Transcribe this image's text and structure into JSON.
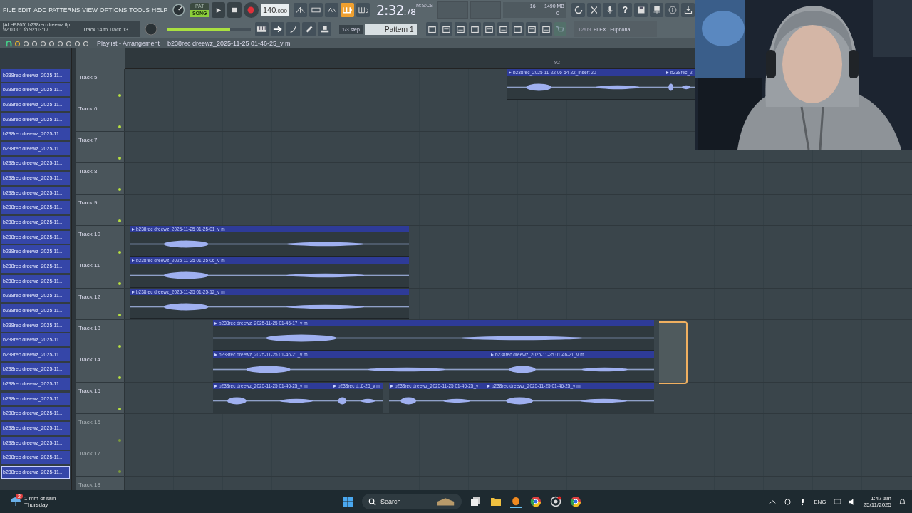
{
  "menu": [
    "FILE",
    "EDIT",
    "ADD",
    "PATTERNS",
    "VIEW",
    "OPTIONS",
    "TOOLS",
    "HELP"
  ],
  "transport": {
    "modes": [
      {
        "label": "PAT",
        "selected": false
      },
      {
        "label": "SONG",
        "selected": true
      }
    ],
    "tempo": "140",
    "tempo_fraction": ".000",
    "time": "2:32",
    "time_cs": ":78",
    "time_format": "M:S:CS"
  },
  "top_buttons": [
    {
      "on": false
    },
    {
      "on": false
    },
    {
      "on": false
    },
    {
      "on": true
    },
    {
      "on": false
    }
  ],
  "hint": {
    "title": "[ALH9865] b238rec dreewz.flp",
    "range": "92:03:01 to 92:03:17",
    "detail": "Track 14 to Track 13"
  },
  "master_volume": {
    "level": 0.75
  },
  "snap": "1/3 step",
  "pattern": "Pattern 1",
  "cpu": {
    "voices": "16",
    "memory": "1490 MB",
    "polyphony": "0"
  },
  "help_glyph": "?",
  "news": {
    "date": "12/09",
    "text": "FLEX | Euphoria"
  },
  "breadcrumb": [
    "Playlist - Arrangement",
    "b238rec dreewz_2025-11-25 01-46-25_v m"
  ],
  "ruler": {
    "marker": "92"
  },
  "browser": {
    "items": [
      {
        "label": "b238rec dreewz_2025-11…",
        "selected": false
      },
      {
        "label": "b238rec dreewz_2025-11…",
        "selected": false
      },
      {
        "label": "b238rec dreewz_2025-11…",
        "selected": false
      },
      {
        "label": "b238rec dreewz_2025-11…",
        "selected": false
      },
      {
        "label": "b238rec dreewz_2025-11…",
        "selected": false
      },
      {
        "label": "b238rec dreewz_2025-11…",
        "selected": false
      },
      {
        "label": "b238rec dreewz_2025-11…",
        "selected": false
      },
      {
        "label": "b238rec dreewz_2025-11…",
        "selected": false
      },
      {
        "label": "b238rec dreewz_2025-11…",
        "selected": false
      },
      {
        "label": "b238rec dreewz_2025-11…",
        "selected": false
      },
      {
        "label": "b238rec dreewz_2025-11…",
        "selected": false
      },
      {
        "label": "b238rec dreewz_2025-11…",
        "selected": false
      },
      {
        "label": "b238rec dreewz_2025-11…",
        "selected": false
      },
      {
        "label": "b238rec dreewz_2025-11…",
        "selected": false
      },
      {
        "label": "b238rec dreewz_2025-11…",
        "selected": false
      },
      {
        "label": "b238rec dreewz_2025-11…",
        "selected": false
      },
      {
        "label": "b238rec dreewz_2025-11…",
        "selected": false
      },
      {
        "label": "b238rec dreewz_2025-11…",
        "selected": false
      },
      {
        "label": "b238rec dreewz_2025-11…",
        "selected": false
      },
      {
        "label": "b238rec dreewz_2025-11…",
        "selected": false
      },
      {
        "label": "b238rec dreewz_2025-11…",
        "selected": false
      },
      {
        "label": "b238rec dreewz_2025-11…",
        "selected": false
      },
      {
        "label": "b238rec dreewz_2025-11…",
        "selected": false
      },
      {
        "label": "b238rec dreewz_2025-11…",
        "selected": false
      },
      {
        "label": "b238rec dreewz_2025-11…",
        "selected": false
      },
      {
        "label": "b238rec dreewz_2025-11…",
        "selected": false
      },
      {
        "label": "b238rec dreewz_2025-11…",
        "selected": false
      },
      {
        "label": "b238rec dreewz_2025-11…",
        "selected": true
      }
    ]
  },
  "tracks": [
    {
      "name": "Track 5",
      "disabled": false,
      "clips": [
        {
          "label": "b238rec_2025-11-22 06-54-22_Insert 20"
        },
        {
          "label": "b238rec_2"
        }
      ]
    },
    {
      "name": "Track 6",
      "disabled": false
    },
    {
      "name": "Track 7",
      "disabled": false
    },
    {
      "name": "Track 8",
      "disabled": false
    },
    {
      "name": "Track 9",
      "disabled": false
    },
    {
      "name": "Track 10",
      "disabled": false,
      "clips": [
        {
          "label": "b238rec dreewz_2025-11-25 01-25-01_v m"
        }
      ]
    },
    {
      "name": "Track 11",
      "disabled": false,
      "clips": [
        {
          "label": "b238rec dreewz_2025-11-25 01-25-06_v m"
        }
      ]
    },
    {
      "name": "Track 12",
      "disabled": false,
      "clips": [
        {
          "label": "b238rec dreewz_2025-11-25 01-25-12_v m"
        }
      ]
    },
    {
      "name": "Track 13",
      "disabled": false,
      "clips": [
        {
          "label": "b238rec dreewz_2025-11-25 01-46-17_v m"
        }
      ]
    },
    {
      "name": "Track 14",
      "disabled": false,
      "clips": [
        {
          "label": "b238rec dreewz_2025-11-25 01-46-21_v m"
        },
        {
          "label": "b238rec dreewz_2025-11-25 01-46-21_v m"
        }
      ]
    },
    {
      "name": "Track 15",
      "disabled": false,
      "clips": [
        {
          "label": "b238rec dreewz_2025-11-25 01-46-25_v m"
        },
        {
          "label": "b238rec d..6-25_v m"
        },
        {
          "label": "b238rec dreewz_2025-11-25 01-46-25_v"
        },
        {
          "label": "b238rec dreewz_2025-11-25 01-46-25_v m"
        }
      ]
    },
    {
      "name": "Track 16",
      "disabled": true
    },
    {
      "name": "Track 17",
      "disabled": true
    },
    {
      "name": "Track 18",
      "disabled": true
    }
  ],
  "taskbar": {
    "weather": {
      "badge": "2",
      "text": "1 mm of rain",
      "day": "Thursday"
    },
    "search": {
      "placeholder": "Search"
    },
    "language": "ENG",
    "time": "1:47 am",
    "date": "25/11/2025"
  }
}
